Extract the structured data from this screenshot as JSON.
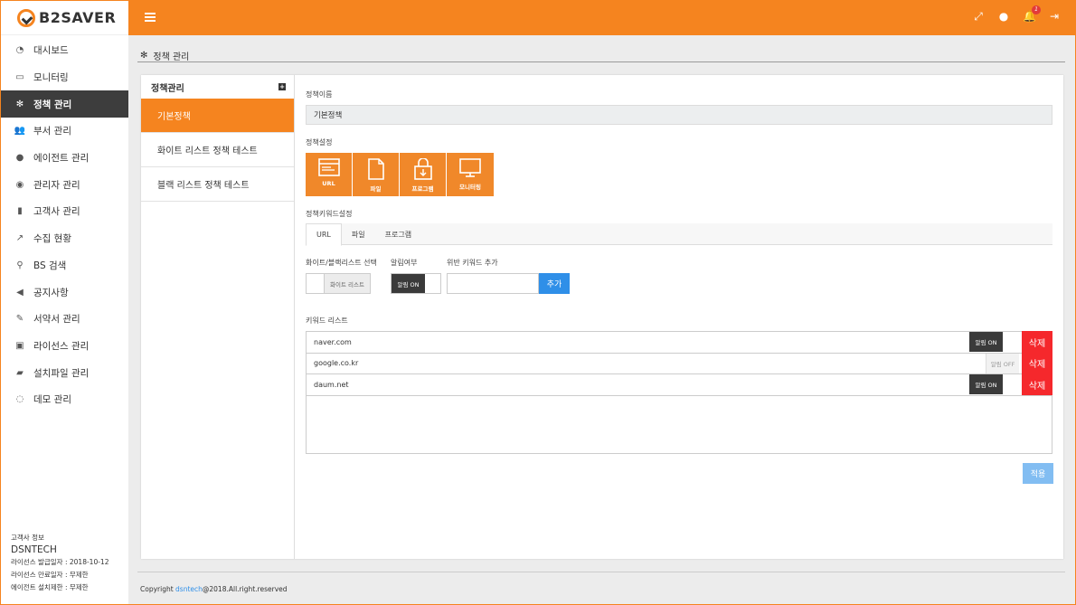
{
  "brand": {
    "logo_text_pre": "B2SA",
    "logo_text_mid": "V",
    "logo_text_post": "ER"
  },
  "sidebar": {
    "items": [
      {
        "label": "대시보드",
        "icon": "dashboard-icon",
        "glyph": "◔"
      },
      {
        "label": "모니터링",
        "icon": "monitor-icon",
        "glyph": "▭"
      },
      {
        "label": "정책 관리",
        "icon": "gear-icon",
        "glyph": "✻",
        "active": true
      },
      {
        "label": "부서 관리",
        "icon": "users-icon",
        "glyph": "👥"
      },
      {
        "label": "에이전트 관리",
        "icon": "user-icon",
        "glyph": "●"
      },
      {
        "label": "관리자 관리",
        "icon": "user-circle-icon",
        "glyph": "◉"
      },
      {
        "label": "고객사 관리",
        "icon": "building-icon",
        "glyph": "▮"
      },
      {
        "label": "수집 현황",
        "icon": "chart-icon",
        "glyph": "↗"
      },
      {
        "label": "BS 검색",
        "icon": "search-icon",
        "glyph": "⚲"
      },
      {
        "label": "공지사항",
        "icon": "megaphone-icon",
        "glyph": "◀"
      },
      {
        "label": "서약서 관리",
        "icon": "edit-icon",
        "glyph": "✎"
      },
      {
        "label": "라이선스 관리",
        "icon": "license-icon",
        "glyph": "▣"
      },
      {
        "label": "설치파일 관리",
        "icon": "folder-icon",
        "glyph": "▰"
      },
      {
        "label": "데모 관리",
        "icon": "comment-icon",
        "glyph": "◌"
      }
    ]
  },
  "customer": {
    "heading": "고객사 정보",
    "company": "DSNTECH",
    "issue_date": "라이선스 발급일자 : 2018-10-12",
    "expire_date": "라이선스 만료일자 : 무제한",
    "install_limit": "에이전트 설치제한 : 무제한"
  },
  "topbar": {
    "notification_count": "1",
    "icons": [
      "expand-icon",
      "user-icon",
      "bell-icon",
      "logout-icon"
    ]
  },
  "page": {
    "title": "정책 관리"
  },
  "policy_list": {
    "heading": "정책관리",
    "items": [
      "기본정책",
      "화이트 리스트 정책 테스트",
      "블랙 리스트 정책 테스트"
    ],
    "active_index": 0
  },
  "form": {
    "name_label": "정책이름",
    "name_value": "기본정책",
    "settings_label": "정책설정",
    "settings": [
      "URL",
      "파일",
      "프로그램",
      "모니터링"
    ],
    "keyword_settings_label": "정책키워드설정",
    "tabs": [
      "URL",
      "파일",
      "프로그램"
    ],
    "active_tab": 0,
    "list_type_label": "화이트/블랙리스트 선택",
    "list_type_value": "화이트 리스트",
    "alert_label": "알림여부",
    "alert_value": "알림 ON",
    "add_keyword_label": "위반 키워드 추가",
    "add_button": "추가",
    "keyword_list_label": "키워드 리스트",
    "keywords": [
      {
        "text": "naver.com",
        "alert": "알림 ON",
        "on": true
      },
      {
        "text": "google.co.kr",
        "alert": "알림 OFF",
        "on": false
      },
      {
        "text": "daum.net",
        "alert": "알림 ON",
        "on": true
      }
    ],
    "delete_label": "삭제",
    "apply_button": "적용"
  },
  "footer": {
    "prefix": "Copyright ",
    "link": "dsntech",
    "suffix": "@2018.All.right.reserved"
  },
  "colors": {
    "accent": "#f5841f",
    "dark": "#3d3d3d",
    "primary": "#2f8fe8",
    "danger": "#f5282c"
  }
}
